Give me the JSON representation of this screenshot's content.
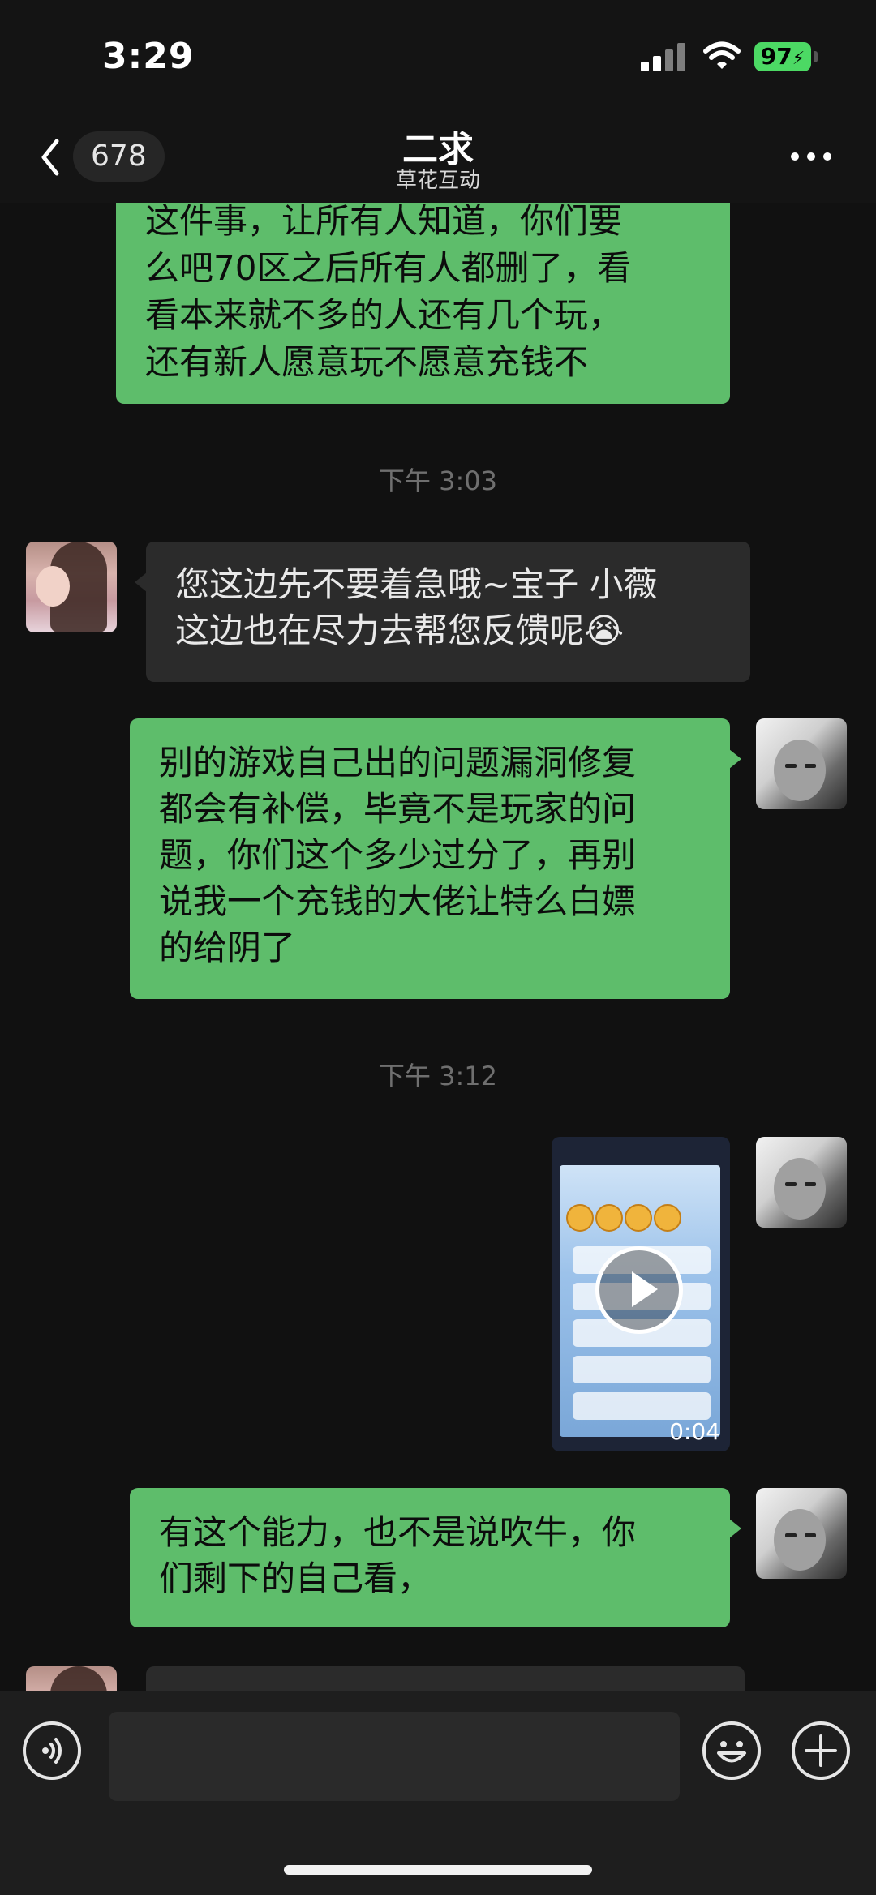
{
  "status_bar": {
    "time": "3:29",
    "battery": "97",
    "icons": [
      "signal-icon",
      "wifi-icon",
      "battery-charging-icon"
    ]
  },
  "nav": {
    "unread_count": "678",
    "title": "二求",
    "subtitle": "草花互动",
    "icons": [
      "chevron-left-icon",
      "more-icon"
    ]
  },
  "colors": {
    "outgoing_bubble": "#5ebd6b",
    "incoming_bubble": "#2b2b2b",
    "background": "#111111",
    "timestamp": "#6f6f6f"
  },
  "messages": [
    {
      "type": "outgoing",
      "text": "这件事，让所有人知道，你们要\n么吧70区之后所有人都删了，看\n看本来就不多的人还有几个玩，\n还有新人愿意玩不愿意充钱不"
    },
    {
      "type": "timestamp",
      "text": "下午 3:03"
    },
    {
      "type": "incoming",
      "text": "您这边先不要着急哦~宝子 小薇\n这边也在尽力去帮您反馈呢😭"
    },
    {
      "type": "outgoing",
      "text": "别的游戏自己出的问题漏洞修复\n都会有补偿，毕竟不是玩家的问\n题，你们这个多少过分了，再别\n说我一个充钱的大佬让特么白嫖\n的给阴了"
    },
    {
      "type": "timestamp",
      "text": "下午 3:12"
    },
    {
      "type": "outgoing-video",
      "duration": "0:04"
    },
    {
      "type": "outgoing",
      "text": "有这个能力，也不是说吹牛，你\n们剩下的自己看，"
    }
  ],
  "input_bar": {
    "icons": [
      "voice-icon",
      "emoji-icon",
      "plus-icon"
    ]
  }
}
